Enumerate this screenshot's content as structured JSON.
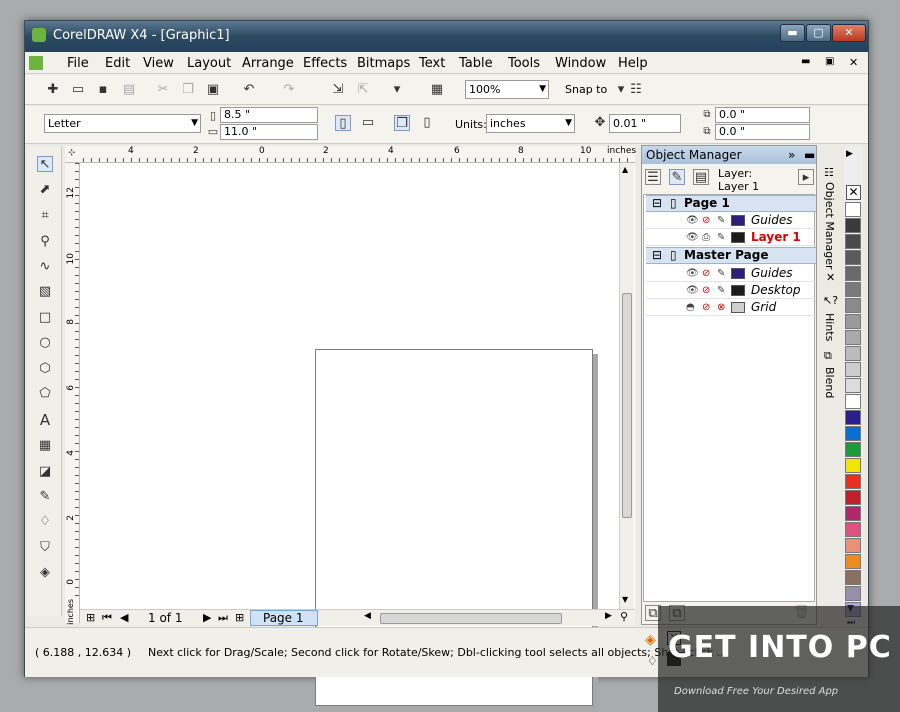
{
  "window": {
    "title": "CorelDRAW X4 - [Graphic1]",
    "min": "▬",
    "max": "▢",
    "close": "✕"
  },
  "menu": {
    "items": [
      "File",
      "Edit",
      "View",
      "Layout",
      "Arrange",
      "Effects",
      "Bitmaps",
      "Text",
      "Table",
      "Tools",
      "Window",
      "Help"
    ]
  },
  "toolbar1": {
    "zoom": "100%",
    "snap_to": "Snap to"
  },
  "propbar": {
    "paper": "Letter",
    "width": "8.5 \"",
    "height": "11.0 \"",
    "units_label": "Units:",
    "units": "inches",
    "nudge": "0.01 \"",
    "dup_x": "0.0 \"",
    "dup_y": "0.0 \""
  },
  "ruler": {
    "h_ticks": [
      "4",
      "2",
      "0",
      "2",
      "4",
      "6",
      "8",
      "10"
    ],
    "h_unit": "inches",
    "v_ticks": [
      "12",
      "10",
      "8",
      "6",
      "4",
      "2",
      "0"
    ],
    "v_unit": "inches"
  },
  "docnav": {
    "page_count": "1 of 1",
    "page_tab": "Page 1"
  },
  "object_manager": {
    "title": "Object Manager",
    "layer_label": "Layer:",
    "layer_value": "Layer 1",
    "groups": [
      {
        "name": "Page 1",
        "rows": [
          {
            "name": "Guides",
            "color": "#2b1f7a",
            "red": false
          },
          {
            "name": "Layer 1",
            "color": "#1c1c1c",
            "red": true
          }
        ]
      },
      {
        "name": "Master Page",
        "rows": [
          {
            "name": "Guides",
            "color": "#2b1f7a",
            "red": false
          },
          {
            "name": "Desktop",
            "color": "#1c1c1c",
            "red": false
          },
          {
            "name": "Grid",
            "color": "#cfcfcf",
            "red": false
          }
        ]
      }
    ]
  },
  "side_tabs": [
    "Object Manager",
    "Hints",
    "Blend"
  ],
  "palette": [
    "#ffffff",
    "#3a3a3a",
    "#4a4a4a",
    "#5a5a5a",
    "#6a6a6a",
    "#7a7a7a",
    "#8a8a8a",
    "#9a9a9a",
    "#aaaaaa",
    "#bbbbbb",
    "#cccccc",
    "#dddddd",
    "#ffffff",
    "#2a1f8c",
    "#0a6fd0",
    "#1a9a3a",
    "#f0e600",
    "#e83020",
    "#c0202a",
    "#b0286a",
    "#e05080",
    "#e89078",
    "#ef8a20",
    "#8a7060",
    "#9a8fa8",
    "#b0a6d8"
  ],
  "status": {
    "coords": "( 6.188 , 12.634 )",
    "message": "Next click for Drag/Scale; Second click for Rotate/Skew; Dbl-clicking tool selects all objects; Shift+click ..."
  },
  "watermark": {
    "brand": "GET INTO PC",
    "tagline": "Download Free Your Desired App"
  }
}
